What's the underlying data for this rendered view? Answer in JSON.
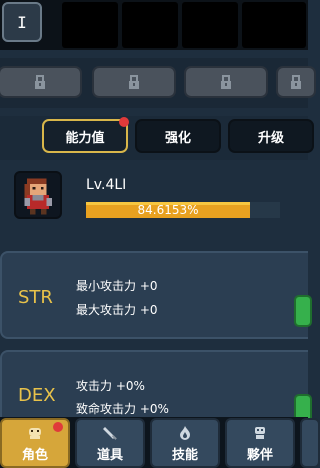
{
  "topbar": {
    "first_slot_label": "I"
  },
  "tabs": [
    {
      "label": "能力值"
    },
    {
      "label": "强化"
    },
    {
      "label": "升级"
    }
  ],
  "profile": {
    "level": "Lv.4LI",
    "exp_percent_text": "84.6153%",
    "exp_progress": 0.846153
  },
  "stats": [
    {
      "name": "STR",
      "lines": [
        "最小攻击力 +0",
        "最大攻击力 +0"
      ]
    },
    {
      "name": "DEX",
      "lines": [
        "攻击力 +0%",
        "致命攻击力 +0%"
      ]
    }
  ],
  "bottom_nav": [
    {
      "label": "角色",
      "icon": "character-icon"
    },
    {
      "label": "道具",
      "icon": "sword-icon"
    },
    {
      "label": "技能",
      "icon": "flame-icon"
    },
    {
      "label": "夥伴",
      "icon": "companion-icon"
    }
  ],
  "colors": {
    "accent_gold": "#d8b64a",
    "exp_fill": "#e8a120",
    "notification": "#e03a3a",
    "stat_label": "#e8c24a",
    "upgrade_button": "#36b04c"
  }
}
